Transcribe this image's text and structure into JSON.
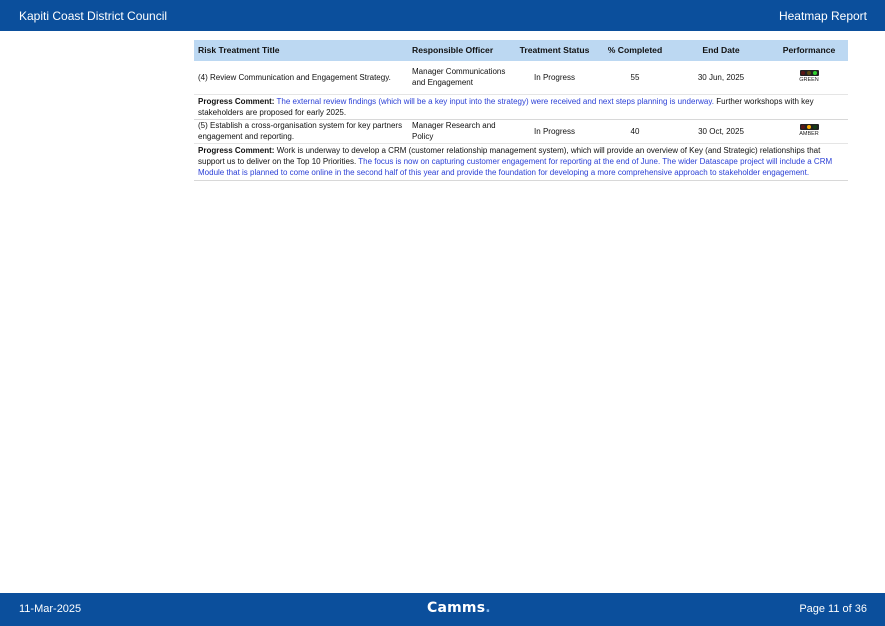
{
  "header": {
    "org": "Kapiti Coast District Council",
    "report_title": "Heatmap Report"
  },
  "table": {
    "columns": [
      "Risk Treatment Title",
      "Responsible Officer",
      "Treatment Status",
      "% Completed",
      "End Date",
      "Performance"
    ],
    "rows": [
      {
        "title": "(4) Review Communication and Engagement Strategy.",
        "officer": "Manager Communications and Engagement",
        "status": "In Progress",
        "completed": "55",
        "end_date": "30 Jun, 2025",
        "performance": "GREEN",
        "comment_label": "Progress Comment:",
        "comment_blue": "The external review findings (which will be a key input into the strategy) were received and next steps planning is underway.",
        "comment_black": "Further workshops with key stakeholders are proposed for early 2025."
      },
      {
        "title": "(5) Establish a cross-organisation system for key partners engagement and reporting.",
        "officer": "Manager Research and Policy",
        "status": "In Progress",
        "completed": "40",
        "end_date": "30 Oct, 2025",
        "performance": "AMBER",
        "comment_label": "Progress Comment:",
        "comment_black": "Work is underway to develop a CRM (customer relationship management system), which will provide an overview of Key (and Strategic) relationships that support us to deliver on the Top 10 Priorities.",
        "comment_blue": "The focus is now on capturing customer engagement for reporting at the end of June. The wider Datascape project will include a CRM Module that is planned to come online in the second half of this year and provide the foundation for developing a more comprehensive approach to stakeholder engagement."
      }
    ]
  },
  "colors": {
    "bar": "#0b4f9c",
    "header_row": "#bcd8f2",
    "comment_blue": "#2a3fd6",
    "status_green": "#2fd12f",
    "status_amber": "#ffb000"
  },
  "footer": {
    "date": "11-Mar-2025",
    "logo": "Camms",
    "logo_dot": ".",
    "page": "Page 11 of 36"
  }
}
